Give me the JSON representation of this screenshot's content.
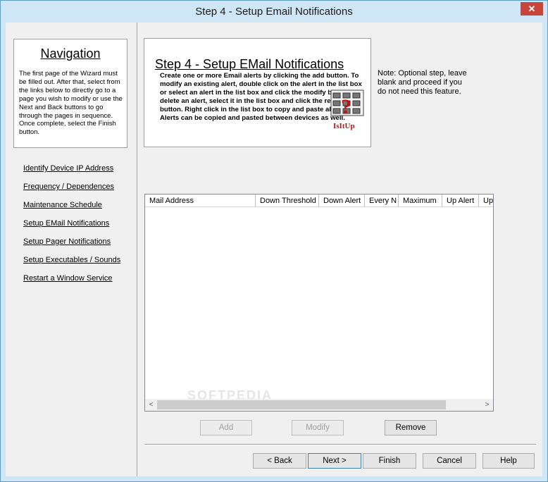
{
  "window": {
    "title": "Step 4 - Setup Email Notifications",
    "close_glyph": "✕"
  },
  "navigation": {
    "title": "Navigation",
    "description": "The first page of the Wizard must be filled out. After that, select from the links below to directly go to a page you wish to modify or use the Next and Back buttons to go through the pages in sequence. Once complete, select the Finish button.",
    "links": [
      "Identify Device IP Address",
      "Frequency / Dependences",
      "Maintenance Schedule",
      "Setup EMail Notifications",
      "Setup Pager Notifications",
      "Setup Executables / Sounds",
      "Restart a Window Service"
    ]
  },
  "banner": {
    "title": "Step 4 - Setup EMail Notifications",
    "text": "Create one or more Email alerts by clicking the add button. To modify an existing alert, double click on the alert in the list box or select an alert in the list box and click the modify button.To delete an alert, select it in the list box and click the remove button. Right click in the list box to copy and paste alerts. Note: Alerts can be copied and pasted between devices as well.",
    "logo_text": "IsItUp"
  },
  "note": "Note: Optional step, leave blank and proceed if you do not need this feature.",
  "list": {
    "columns": [
      "Mail Address",
      "Down Threshold",
      "Down Alert",
      "Every N",
      "Maximum",
      "Up Alert",
      "Up"
    ],
    "rows": [],
    "scroll_left": "<",
    "scroll_right": ">"
  },
  "list_buttons": {
    "add": "Add",
    "modify": "Modify",
    "remove": "Remove"
  },
  "footer": {
    "back": "< Back",
    "next": "Next >",
    "finish": "Finish",
    "cancel": "Cancel",
    "help": "Help"
  },
  "watermark": "SOFTPEDIA",
  "colors": {
    "titlebar": "#cfe6f6",
    "close": "#c8453c",
    "face": "#f0f0f0",
    "logo_red": "#c01010"
  }
}
